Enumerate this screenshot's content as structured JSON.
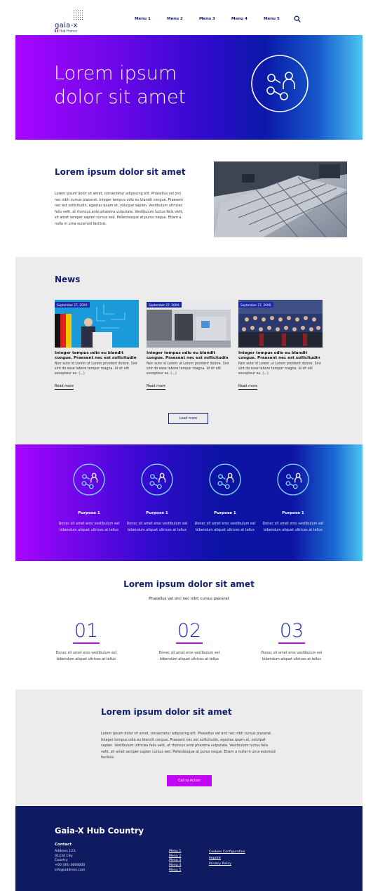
{
  "header": {
    "logo_text": "gaia-x",
    "logo_sub": "Hub France",
    "menu": [
      "Menu 1",
      "Menu 2",
      "Menu 3",
      "Menu 4",
      "Menu 5"
    ]
  },
  "hero": {
    "title": "Lorem ipsum dolor sit amet"
  },
  "intro": {
    "title": "Lorem ipsum dolor sit amet",
    "text": "Lorem ipsum dolor sit amet, consectetur adipiscing elit. Phasellus vel orci nec nibh cursus placerat. Integer tempus odio eu blandit congue. Praesent nec est sollicitudin, egestas quam et, volutpat sapien. Vestibulum ultricies felis velit, at rhoncus ante pharetra vulputate. Vestibulum luctus felis velit, sit amet semper sapien cursus sed. Pellentesque at purus neque. Etiam a nulla in urna euismod facilisis."
  },
  "news": {
    "title": "News",
    "items": [
      {
        "date": "September 27, 20XX",
        "title": "Integer tempus odio eu blandit congue. Praesent nec est sollicitudin",
        "text": "Non aute id Lorem ut Lorem proident dolore. Sint sint do esse labore tempor magna. Id sit elit excepteur ex. (...)",
        "link": "Read more"
      },
      {
        "date": "September 27, 20XX",
        "title": "Integer tempus odio eu blandit congue. Praesent nec est sollicitudin",
        "text": "Non aute id Lorem ut Lorem proident dolore. Sint sint do esse labore tempor magna. Id sit elit excepteur ex. (...)",
        "link": "Read more"
      },
      {
        "date": "September 27, 20XX",
        "title": "Integer tempus odio eu blandit congue. Praesent nec est sollicitudin",
        "text": "Non aute id Lorem ut Lorem proident dolore. Sint sint do esse labore tempor magna. Id sit elit excepteur ex. (...)",
        "link": "Read more"
      }
    ],
    "load_more": "Load more"
  },
  "purposes": [
    {
      "name": "Purpose 1",
      "text": "Donec sit amet eros vestibulum est bibendum aliquet ultrices at tellus"
    },
    {
      "name": "Purpose 1",
      "text": "Donec sit amet eros vestibulum est bibendum aliquet ultrices at tellus"
    },
    {
      "name": "Purpose 1",
      "text": "Donec sit amet eros vestibulum est bibendum aliquet ultrices at tellus"
    },
    {
      "name": "Purpose 1",
      "text": "Donec sit amet eros vestibulum est bibendum aliquet ultrices at tellus"
    }
  ],
  "steps": {
    "title": "Lorem ipsum dolor sit amet",
    "subtitle": "Phasellus vel orci nec nibh cursus placerat",
    "items": [
      {
        "num": "01",
        "text": "Donec sit amet eros vestibulum est bibendum aliquet ultrices at tellus"
      },
      {
        "num": "02",
        "text": "Donec sit amet eros vestibulum est bibendum aliquet ultrices at tellus"
      },
      {
        "num": "03",
        "text": "Donec sit amet eros vestibulum est bibendum aliquet ultrices at tellus"
      }
    ]
  },
  "cta": {
    "title": "Lorem ipsum dolor sit amet",
    "text": "Lorem ipsum dolor sit amet, consectetur adipiscing elit. Phasellus vel orci nec nibh cursus placerat. Integer tempus odio eu blandit congue. Praesent nec est sollicitudin, egestas quam et, volutpat sapien. Vestibulum ultricies felis velit, at rhoncus ante pharetra vulputate. Vestibulum luctus felis velit, sit amet semper sapien cursus sed. Pellentesque at purus neque. Etiam a nulla in urna euismod facilisis.",
    "button": "Call to Action"
  },
  "footer": {
    "title": "Gaia-X Hub Country",
    "contact_heading": "Contact",
    "contact_lines": [
      "Address 123,",
      "01234 City",
      "Country",
      "+00 (00) 0000000",
      "info@address.com"
    ],
    "menu": [
      "Menu 1",
      "Menu 2",
      "Menu 3",
      "Menu 4",
      "Menu 5"
    ],
    "legal": [
      "Cookies Configuration",
      "Imprint",
      "Privacy Policy"
    ]
  },
  "colors": {
    "brand_navy": "#13206e",
    "accent_magenta": "#c208f3",
    "footer_bg": "#0e1b60",
    "section_grey": "#ececec"
  }
}
